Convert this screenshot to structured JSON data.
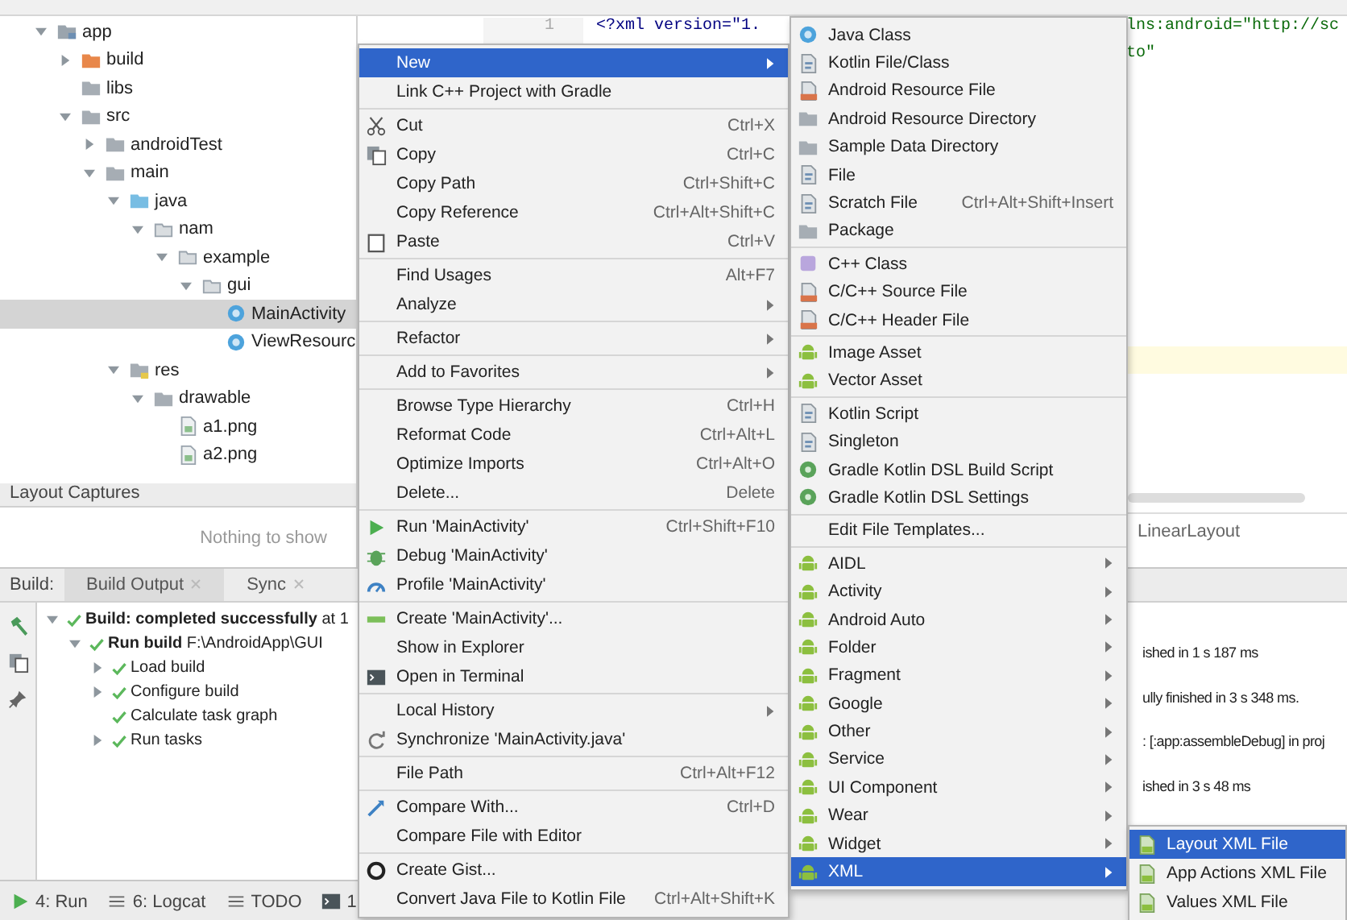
{
  "project_tree": [
    {
      "name": "app",
      "kind": "module",
      "expanded": true,
      "selected": false,
      "children": [
        {
          "name": "build",
          "kind": "excluded-folder",
          "expanded": false,
          "selected": false
        },
        {
          "name": "libs",
          "kind": "folder",
          "selected": false
        },
        {
          "name": "src",
          "kind": "folder",
          "expanded": true,
          "selected": false,
          "children": [
            {
              "name": "androidTest",
              "kind": "folder",
              "expanded": false,
              "selected": false
            },
            {
              "name": "main",
              "kind": "folder",
              "expanded": true,
              "selected": false,
              "children": [
                {
                  "name": "java",
                  "kind": "source-folder",
                  "expanded": true,
                  "selected": false,
                  "children": [
                    {
                      "name": "nam",
                      "kind": "package",
                      "expanded": true,
                      "selected": false,
                      "children": [
                        {
                          "name": "example",
                          "kind": "package",
                          "expanded": true,
                          "selected": false,
                          "children": [
                            {
                              "name": "gui",
                              "kind": "package",
                              "expanded": true,
                              "selected": false,
                              "children": [
                                {
                                  "name": "MainActivity",
                                  "kind": "class",
                                  "selected": true
                                },
                                {
                                  "name": "ViewResourc",
                                  "kind": "class",
                                  "selected": false
                                }
                              ]
                            }
                          ]
                        }
                      ]
                    }
                  ]
                },
                {
                  "name": "res",
                  "kind": "resource-folder",
                  "expanded": true,
                  "selected": false,
                  "children": [
                    {
                      "name": "drawable",
                      "kind": "folder",
                      "expanded": true,
                      "selected": false,
                      "children": [
                        {
                          "name": "a1.png",
                          "kind": "image",
                          "selected": false
                        },
                        {
                          "name": "a2.png",
                          "kind": "image",
                          "selected": false
                        }
                      ]
                    }
                  ]
                }
              ]
            }
          ]
        }
      ]
    }
  ],
  "editor": {
    "line_number": "1",
    "code": "<?xml version=\"1.",
    "code_right": [
      "lns:android=\"http://sc",
      "to\""
    ],
    "breadcrumb": "LinearLayout"
  },
  "layout_captures": {
    "title": "Layout Captures",
    "empty_text": "Nothing to show"
  },
  "build_panel": {
    "label": "Build:",
    "tabs": [
      {
        "label": "Build Output",
        "selected": true
      },
      {
        "label": "Sync",
        "selected": false
      }
    ],
    "tree": [
      {
        "text": "**Build: completed successfully** at 1",
        "expanded": true,
        "children": [
          {
            "text": "**Run build** F:\\AndroidApp\\GUI",
            "expanded": true,
            "children": [
              {
                "text": "Load build",
                "expanded": false
              },
              {
                "text": "Configure build",
                "expanded": false
              },
              {
                "text": "Calculate task graph"
              },
              {
                "text": "Run tasks",
                "expanded": false
              }
            ]
          }
        ]
      }
    ],
    "console": [
      "ished in 1 s 187 ms",
      "ully finished in 3 s 348 ms.",
      ": [:app:assembleDebug] in proj",
      "ished in 3 s 48 ms"
    ]
  },
  "status_bar": [
    {
      "label": "4: Run"
    },
    {
      "label": "6: Logcat"
    },
    {
      "label": "TODO"
    },
    {
      "label": "1"
    }
  ],
  "context_menu": [
    {
      "kind": "item",
      "label": "New",
      "submenu": true,
      "selected": true
    },
    {
      "kind": "item",
      "label": "Link C++ Project with Gradle",
      "submenu": false,
      "selected": false
    },
    {
      "kind": "separator"
    },
    {
      "kind": "item",
      "label": "Cut",
      "shortcut": "Ctrl+X",
      "submenu": false,
      "selected": false
    },
    {
      "kind": "item",
      "label": "Copy",
      "shortcut": "Ctrl+C",
      "submenu": false,
      "selected": false
    },
    {
      "kind": "item",
      "label": "Copy Path",
      "shortcut": "Ctrl+Shift+C",
      "submenu": false,
      "selected": false
    },
    {
      "kind": "item",
      "label": "Copy Reference",
      "shortcut": "Ctrl+Alt+Shift+C",
      "submenu": false,
      "selected": false
    },
    {
      "kind": "item",
      "label": "Paste",
      "shortcut": "Ctrl+V",
      "submenu": false,
      "selected": false
    },
    {
      "kind": "separator"
    },
    {
      "kind": "item",
      "label": "Find Usages",
      "shortcut": "Alt+F7",
      "submenu": false,
      "selected": false
    },
    {
      "kind": "item",
      "label": "Analyze",
      "submenu": true,
      "selected": false
    },
    {
      "kind": "separator"
    },
    {
      "kind": "item",
      "label": "Refactor",
      "submenu": true,
      "selected": false
    },
    {
      "kind": "separator"
    },
    {
      "kind": "item",
      "label": "Add to Favorites",
      "submenu": true,
      "selected": false
    },
    {
      "kind": "separator"
    },
    {
      "kind": "item",
      "label": "Browse Type Hierarchy",
      "shortcut": "Ctrl+H",
      "submenu": false,
      "selected": false
    },
    {
      "kind": "item",
      "label": "Reformat Code",
      "shortcut": "Ctrl+Alt+L",
      "submenu": false,
      "selected": false
    },
    {
      "kind": "item",
      "label": "Optimize Imports",
      "shortcut": "Ctrl+Alt+O",
      "submenu": false,
      "selected": false
    },
    {
      "kind": "item",
      "label": "Delete...",
      "shortcut": "Delete",
      "submenu": false,
      "selected": false
    },
    {
      "kind": "separator"
    },
    {
      "kind": "item",
      "label": "Run 'MainActivity'",
      "shortcut": "Ctrl+Shift+F10",
      "submenu": false,
      "selected": false
    },
    {
      "kind": "item",
      "label": "Debug 'MainActivity'",
      "submenu": false,
      "selected": false
    },
    {
      "kind": "item",
      "label": "Profile 'MainActivity'",
      "submenu": false,
      "selected": false
    },
    {
      "kind": "separator"
    },
    {
      "kind": "item",
      "label": "Create 'MainActivity'...",
      "submenu": false,
      "selected": false
    },
    {
      "kind": "item",
      "label": "Show in Explorer",
      "submenu": false,
      "selected": false
    },
    {
      "kind": "item",
      "label": "Open in Terminal",
      "submenu": false,
      "selected": false
    },
    {
      "kind": "separator"
    },
    {
      "kind": "item",
      "label": "Local History",
      "submenu": true,
      "selected": false
    },
    {
      "kind": "item",
      "label": "Synchronize 'MainActivity.java'",
      "submenu": false,
      "selected": false
    },
    {
      "kind": "separator"
    },
    {
      "kind": "item",
      "label": "File Path",
      "shortcut": "Ctrl+Alt+F12",
      "submenu": false,
      "selected": false
    },
    {
      "kind": "separator"
    },
    {
      "kind": "item",
      "label": "Compare With...",
      "shortcut": "Ctrl+D",
      "submenu": false,
      "selected": false
    },
    {
      "kind": "item",
      "label": "Compare File with Editor",
      "submenu": false,
      "selected": false
    },
    {
      "kind": "separator"
    },
    {
      "kind": "item",
      "label": "Create Gist...",
      "submenu": false,
      "selected": false
    },
    {
      "kind": "item",
      "label": "Convert Java File to Kotlin File",
      "shortcut": "Ctrl+Alt+Shift+K",
      "submenu": false,
      "selected": false
    }
  ],
  "new_menu": [
    {
      "kind": "item",
      "label": "Java Class",
      "submenu": false,
      "selected": false
    },
    {
      "kind": "item",
      "label": "Kotlin File/Class",
      "submenu": false,
      "selected": false
    },
    {
      "kind": "item",
      "label": "Android Resource File",
      "submenu": false,
      "selected": false
    },
    {
      "kind": "item",
      "label": "Android Resource Directory",
      "submenu": false,
      "selected": false
    },
    {
      "kind": "item",
      "label": "Sample Data Directory",
      "submenu": false,
      "selected": false
    },
    {
      "kind": "item",
      "label": "File",
      "submenu": false,
      "selected": false
    },
    {
      "kind": "item",
      "label": "Scratch File",
      "shortcut": "Ctrl+Alt+Shift+Insert",
      "submenu": false,
      "selected": false
    },
    {
      "kind": "item",
      "label": "Package",
      "submenu": false,
      "selected": false
    },
    {
      "kind": "separator"
    },
    {
      "kind": "item",
      "label": "C++ Class",
      "submenu": false,
      "selected": false
    },
    {
      "kind": "item",
      "label": "C/C++ Source File",
      "submenu": false,
      "selected": false
    },
    {
      "kind": "item",
      "label": "C/C++ Header File",
      "submenu": false,
      "selected": false
    },
    {
      "kind": "separator"
    },
    {
      "kind": "item",
      "label": "Image Asset",
      "submenu": false,
      "selected": false
    },
    {
      "kind": "item",
      "label": "Vector Asset",
      "submenu": false,
      "selected": false
    },
    {
      "kind": "separator"
    },
    {
      "kind": "item",
      "label": "Kotlin Script",
      "submenu": false,
      "selected": false
    },
    {
      "kind": "item",
      "label": "Singleton",
      "submenu": false,
      "selected": false
    },
    {
      "kind": "item",
      "label": "Gradle Kotlin DSL Build Script",
      "submenu": false,
      "selected": false
    },
    {
      "kind": "item",
      "label": "Gradle Kotlin DSL Settings",
      "submenu": false,
      "selected": false
    },
    {
      "kind": "separator"
    },
    {
      "kind": "item",
      "label": "Edit File Templates...",
      "submenu": false,
      "selected": false
    },
    {
      "kind": "separator"
    },
    {
      "kind": "item",
      "label": "AIDL",
      "submenu": true,
      "selected": false
    },
    {
      "kind": "item",
      "label": "Activity",
      "submenu": true,
      "selected": false
    },
    {
      "kind": "item",
      "label": "Android Auto",
      "submenu": true,
      "selected": false
    },
    {
      "kind": "item",
      "label": "Folder",
      "submenu": true,
      "selected": false
    },
    {
      "kind": "item",
      "label": "Fragment",
      "submenu": true,
      "selected": false
    },
    {
      "kind": "item",
      "label": "Google",
      "submenu": true,
      "selected": false
    },
    {
      "kind": "item",
      "label": "Other",
      "submenu": true,
      "selected": false
    },
    {
      "kind": "item",
      "label": "Service",
      "submenu": true,
      "selected": false
    },
    {
      "kind": "item",
      "label": "UI Component",
      "submenu": true,
      "selected": false
    },
    {
      "kind": "item",
      "label": "Wear",
      "submenu": true,
      "selected": false
    },
    {
      "kind": "item",
      "label": "Widget",
      "submenu": true,
      "selected": false
    },
    {
      "kind": "item",
      "label": "XML",
      "submenu": true,
      "selected": true
    }
  ],
  "xml_menu": [
    {
      "kind": "item",
      "label": "Layout XML File",
      "selected": true
    },
    {
      "kind": "item",
      "label": "App Actions XML File",
      "selected": false
    },
    {
      "kind": "item",
      "label": "Values XML File",
      "selected": false
    }
  ]
}
